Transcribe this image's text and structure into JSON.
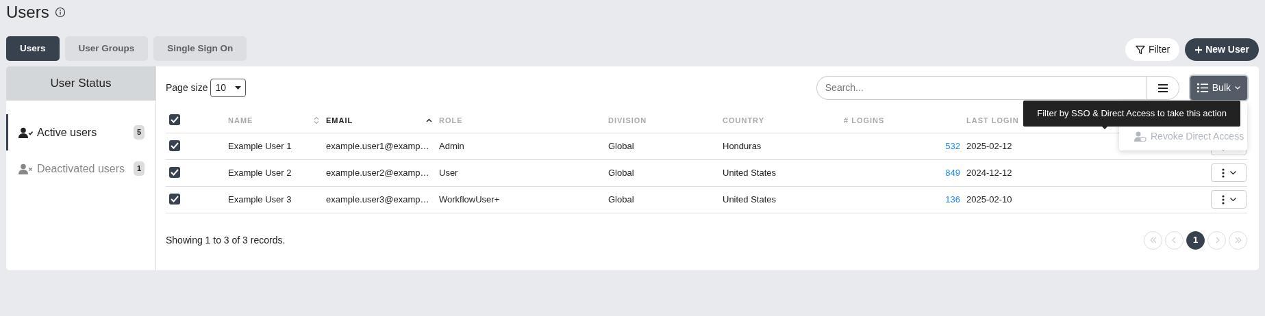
{
  "page": {
    "title": "Users"
  },
  "tabs": [
    {
      "label": "Users",
      "selected": true
    },
    {
      "label": "User Groups",
      "selected": false
    },
    {
      "label": "Single Sign On",
      "selected": false
    }
  ],
  "header_actions": {
    "filter": "Filter",
    "new_user": "New User"
  },
  "sidebar": {
    "title": "User Status",
    "items": [
      {
        "kind": "active",
        "label": "Active users",
        "count": "5",
        "selected": true
      },
      {
        "kind": "deactivated",
        "label": "Deactivated users",
        "count": "1",
        "selected": false
      }
    ]
  },
  "toolbar": {
    "page_size_label": "Page size",
    "page_size": "10",
    "search_placeholder": "Search...",
    "bulk": "Bulk"
  },
  "table": {
    "select_all_checked": true,
    "columns": [
      {
        "label": "NAME",
        "sortable": true,
        "sorted": false
      },
      {
        "label": "EMAIL",
        "sortable": true,
        "sorted": true
      },
      {
        "label": "ROLE",
        "sortable": false,
        "sorted": false
      },
      {
        "label": "DIVISION",
        "sortable": false,
        "sorted": false
      },
      {
        "label": "COUNTRY",
        "sortable": false,
        "sorted": false
      },
      {
        "label": "# LOGINS",
        "sortable": false,
        "sorted": false
      },
      {
        "label": "LAST LOGIN",
        "sortable": false,
        "sorted": false
      }
    ],
    "rows": [
      {
        "checked": true,
        "cells": [
          "Example User 1",
          "example.user1@examp…",
          "Admin",
          "Global",
          "Honduras",
          "532",
          "2025-02-12"
        ]
      },
      {
        "checked": true,
        "cells": [
          "Example User 2",
          "example.user2@examp…",
          "User",
          "Global",
          "United States",
          "849",
          "2024-12-12"
        ]
      },
      {
        "checked": true,
        "cells": [
          "Example User 3",
          "example.user3@examp…",
          "WorkflowUser+",
          "Global",
          "United States",
          "136",
          "2025-02-10"
        ]
      }
    ]
  },
  "bulk_menu": {
    "tooltip": "Filter by SSO & Direct Access to take this action",
    "items": [
      {
        "label": "Revoke Direct Access",
        "disabled": true
      }
    ]
  },
  "footer": {
    "summary": "Showing 1 to 3 of 3 records.",
    "pager": [
      {
        "kind": "first",
        "disabled": true
      },
      {
        "kind": "prev",
        "disabled": true
      },
      {
        "kind": "page",
        "label": "1",
        "selected": true
      },
      {
        "kind": "next",
        "disabled": true
      },
      {
        "kind": "last",
        "disabled": true
      }
    ]
  }
}
